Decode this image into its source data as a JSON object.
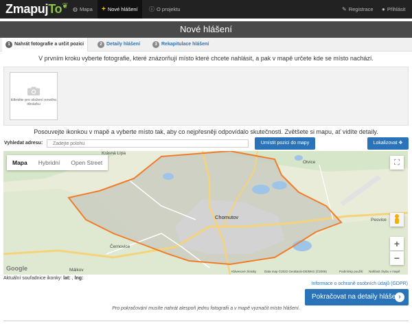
{
  "nav": {
    "brand_main": "Zmapuj",
    "brand_accent": "To",
    "items": [
      {
        "label": "Mapa",
        "icon": "globe-icon"
      },
      {
        "label": "Nové hlášení",
        "icon": "plus-icon"
      },
      {
        "label": "O projektu",
        "icon": "info-icon"
      }
    ],
    "right": [
      {
        "label": "Registrace",
        "icon": "pencil-icon"
      },
      {
        "label": "Přihlásit",
        "icon": "user-icon"
      }
    ]
  },
  "page_title": "Nové hlášení",
  "steps": [
    {
      "num": "1",
      "label": "Nahrát fotografie a určit pozici"
    },
    {
      "num": "2",
      "label": "Detaily hlášení"
    },
    {
      "num": "3",
      "label": "Rekapitulace hlášení"
    }
  ],
  "instruction_photos": "V prvním kroku vyberte fotografie, které znázorňují místo které chcete nahlásit, a pak v mapě určete kde se místo nachází.",
  "upload": {
    "label": "klikněte pro vložení nového obrázku"
  },
  "instruction_map": "Posouvejte ikonkou v mapě a vyberte místo tak, aby co nejpřesněji odpovídalo skutečnosti. Zvětšete si mapu, ať vidíte detaily.",
  "search": {
    "label": "Vyhledat adresu:",
    "placeholder": "Zadejte polohu",
    "place_button": "Umístit pozici do mapy",
    "locate_button": "Lokalizovat"
  },
  "map": {
    "types": [
      "Mapa",
      "Hybridní",
      "Open Street"
    ],
    "places": {
      "krasna_lipa": "Krásná Lípa",
      "otvice": "Otvice",
      "chomutov": "Chomutov",
      "pesvice": "Pesvice",
      "cernovice": "Černovice",
      "malkov": "Málkov"
    },
    "footer": {
      "shortcuts": "Klávesové zkratky",
      "data": "Data map ©2022 GeoBasis-DE/BKG (©2009)",
      "terms": "Podmínky použití",
      "report": "Nahlásit chybu v mapě"
    },
    "google": "Google",
    "colors": {
      "boundary": "#f07c2a",
      "shade": "#c7c9bd",
      "water": "#9ec5e8",
      "road": "#f5d37a"
    }
  },
  "coordinates": {
    "label": "Aktuální souřadnice ikonky:",
    "lat_label": "lat:",
    "sep": ",",
    "lng_label": "lng:"
  },
  "gdpr_link": "Informace o ochraně osobních údajů (GDPR)",
  "continue_button": "Pokračovat na detaily hlášení",
  "note": "Pro pokračování musíte nahrát alespoň jednu fotografii a v mapě vyznačit místo hlášení."
}
